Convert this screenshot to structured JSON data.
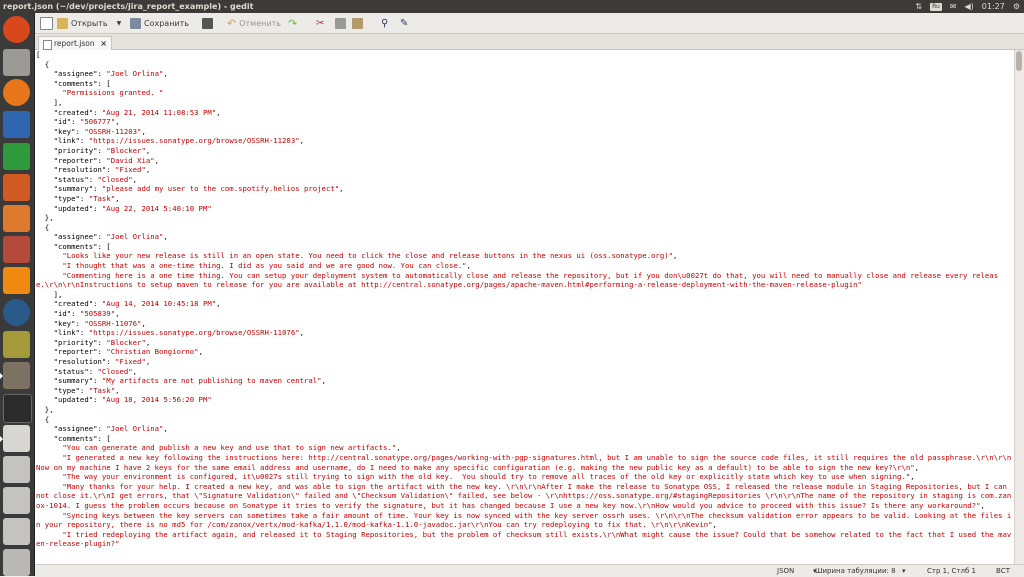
{
  "window": {
    "title": "report.json (~/dev/projects/jira_report_example) - gedit"
  },
  "tray": {
    "keyboard": "Ru",
    "time": "01:27"
  },
  "launcher": {
    "items": [
      "ubuntu-dash",
      "files",
      "firefox",
      "writer",
      "calc",
      "impress",
      "software-center",
      "settings",
      "vlc",
      "browser",
      "updater",
      "gimp",
      "terminal",
      "editor",
      "drive1",
      "drive2",
      "drive3",
      "drive4",
      "trash"
    ]
  },
  "toolbar": {
    "open_label": "Открыть",
    "save_label": "Сохранить",
    "undo_label": "Отменить"
  },
  "tab": {
    "label": "report.json",
    "close": "×"
  },
  "editor": {
    "lines": [
      "[",
      "  {",
      "    \"assignee\": \"Joel Orlina\",",
      "    \"comments\": [",
      "      \"Permissions granted. \"",
      "    ],",
      "    \"created\": \"Aug 21, 2014 11:08:53 PM\",",
      "    \"id\": \"506777\",",
      "    \"key\": \"OSSRH-11203\",",
      "    \"link\": \"https://issues.sonatype.org/browse/OSSRH-11203\",",
      "    \"priority\": \"Blocker\",",
      "    \"reporter\": \"David Xia\",",
      "    \"resolution\": \"Fixed\",",
      "    \"status\": \"Closed\",",
      "    \"summary\": \"please add my user to the com.spotify.helios project\",",
      "    \"type\": \"Task\",",
      "    \"updated\": \"Aug 22, 2014 5:40:10 PM\"",
      "  },",
      "  {",
      "    \"assignee\": \"Joel Orlina\",",
      "    \"comments\": [",
      "      \"Looks like your new release is still in an open state. You need to click the close and release buttons in the nexus ui (oss.sonatype.org)\",",
      "      \"I thought that was a one-time thing. I did as you said and we are good now. You can close.\",",
      "      \"Commenting here is a one time thing. You can setup your deployment system to automatically close and release the repository, but if you don\\u0027t do that, you will need to manually close and release every release.\\r\\n\\r\\nInstructions to setup maven to release for you are available at http://central.sonatype.org/pages/apache-maven.html#performing-a-release-deployment-with-the-maven-release-plugin\"",
      "    ],",
      "    \"created\": \"Aug 14, 2014 10:45:18 PM\",",
      "    \"id\": \"505839\",",
      "    \"key\": \"OSSRH-11076\",",
      "    \"link\": \"https://issues.sonatype.org/browse/OSSRH-11076\",",
      "    \"priority\": \"Blocker\",",
      "    \"reporter\": \"Christian Bongiorno\",",
      "    \"resolution\": \"Fixed\",",
      "    \"status\": \"Closed\",",
      "    \"summary\": \"My artifacts are not publishing to maven central\",",
      "    \"type\": \"Task\",",
      "    \"updated\": \"Aug 18, 2014 5:56:20 PM\"",
      "  },",
      "  {",
      "    \"assignee\": \"Joel Orlina\",",
      "    \"comments\": [",
      "      \"You can generate and publish a new key and use that to sign new artifacts.\",",
      "      \"I generated a new key following the instructions here: http://central.sonatype.org/pages/working-with-pgp-signatures.html, but I am unable to sign the source code files, it still requires the old passphrase.\\r\\n\\r\\nNow on my machine I have 2 keys for the same email address and username, do I need to make any specific configuration (e.g. making the new public key as a default) to be able to sign the new key?\\r\\n\",",
      "      \"The way your environment is configured, it\\u0027s still trying to sign with the old key.  You should try to remove all traces of the old key or explicitly state which key to use when signing.\",",
      "      \"Many thanks for your help. I created a new key, and was able to sign the artifact with the new key. \\r\\n\\r\\nAfter I make the release to Sonatype OSS, I released the release module in Staging Repositories, but I can not close it.\\r\\nI get errors, that \\\"Signature Validation\\\" failed and \\\"Checksum Validation\\\" failed, see below - \\r\\nhttps://oss.sonatype.org/#stagingRepositories \\r\\n\\r\\nThe name of the repository in staging is com.zanox-1014. I guess the problem occurs because on Sonatype it tries to verify the signature, but it has changed because I use a new key now.\\r\\nHow would you advice to proceed with this issue? Is there any workaround?\",",
      "      \"Syncing keys between the key servers can sometimes take a fair amount of time. Your key is now synced with the key server ossrh uses. \\r\\n\\r\\nThe checksum validation error appears to be valid. Looking at the files in your repository, there is no md5 for /com/zanox/vertx/mod-kafka/1.1.0/mod-kafka-1.1.0-javadoc.jar\\r\\nYou can try redeploying to fix that. \\r\\n\\r\\nKevin\",",
      "      \"I tried redeploying the artifact again, and released it to Staging Repositories, but the problem of checksum still exists.\\r\\nWhat might cause the issue? Could that be somehow related to the fact that I used the maven-release-plugin?\""
    ]
  },
  "status": {
    "language": "JSON",
    "tab_width": "Ширина табуляции: 8",
    "position": "Стр 1, Стлб 1",
    "mode": "ВСТ"
  },
  "colors": {
    "string": "#c40000",
    "key_text": "#000000",
    "panel": "#3c3b37"
  }
}
